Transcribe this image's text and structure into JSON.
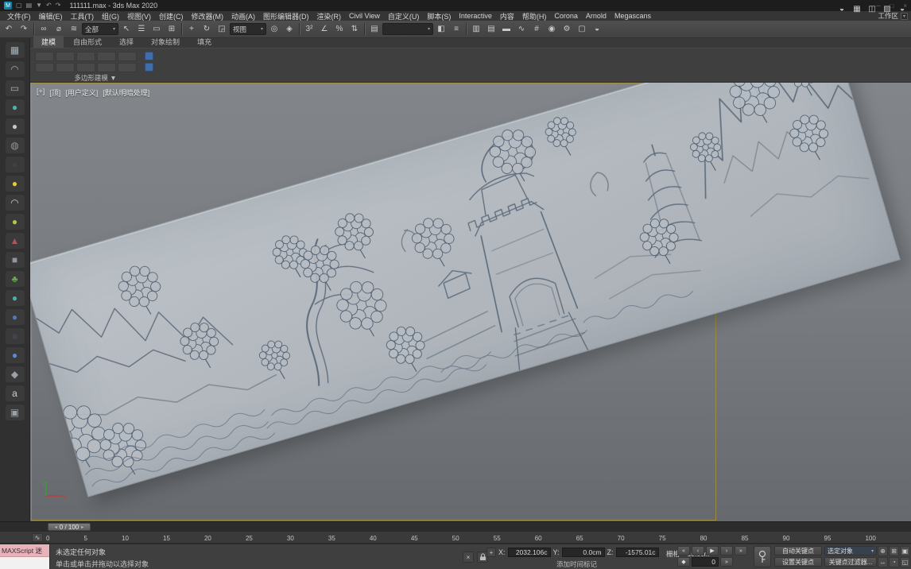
{
  "window": {
    "title": "111111.max - 3ds Max 2020",
    "logo": "M",
    "controls": [
      "─",
      "□",
      "×"
    ]
  },
  "quick_access": {
    "icons": [
      {
        "n": "new-file-icon",
        "g": "▢"
      },
      {
        "n": "open-file-icon",
        "g": "▤"
      },
      {
        "n": "save-file-icon",
        "g": "▼"
      },
      {
        "n": "undo-small-icon",
        "g": "↶"
      },
      {
        "n": "redo-small-icon",
        "g": "↷"
      }
    ]
  },
  "menu_bar": {
    "items": [
      "文件(F)",
      "编辑(E)",
      "工具(T)",
      "组(G)",
      "视图(V)",
      "创建(C)",
      "修改器(M)",
      "动画(A)",
      "图形编辑器(D)",
      "渲染(R)",
      "Civil View",
      "自定义(U)",
      "脚本(S)",
      "Interactive",
      "内容",
      "帮助(H)",
      "Corona",
      "Arnold",
      "Megascans"
    ],
    "workspace_label": "工作区"
  },
  "toolbar": {
    "buttons": [
      {
        "t": "i",
        "n": "undo-icon",
        "g": "↶"
      },
      {
        "t": "i",
        "n": "redo-icon",
        "g": "↷"
      },
      {
        "t": "s"
      },
      {
        "t": "i",
        "n": "select-and-link-icon",
        "g": "∞"
      },
      {
        "t": "i",
        "n": "unlink-selection-icon",
        "g": "⌀"
      },
      {
        "t": "i",
        "n": "bind-to-space-warp-icon",
        "g": "≋"
      },
      {
        "t": "d",
        "n": "selection-filter-dropdown",
        "v": "全部"
      },
      {
        "t": "i",
        "n": "select-object-icon",
        "g": "↖"
      },
      {
        "t": "i",
        "n": "select-by-name-icon",
        "g": "☰"
      },
      {
        "t": "i",
        "n": "rectangular-selection-region-icon",
        "g": "▭"
      },
      {
        "t": "i",
        "n": "window-crossing-icon",
        "g": "⊞"
      },
      {
        "t": "s"
      },
      {
        "t": "i",
        "n": "select-and-move-icon",
        "g": "+"
      },
      {
        "t": "i",
        "n": "select-and-rotate-icon",
        "g": "↻"
      },
      {
        "t": "i",
        "n": "select-and-scale-icon",
        "g": "◲"
      },
      {
        "t": "d",
        "n": "reference-coordinate-dropdown",
        "v": "视图"
      },
      {
        "t": "i",
        "n": "use-pivot-point-icon",
        "g": "◎"
      },
      {
        "t": "i",
        "n": "select-and-manipulate-icon",
        "g": "◈"
      },
      {
        "t": "s"
      },
      {
        "t": "i",
        "n": "snaps-toggle-icon",
        "g": "3²"
      },
      {
        "t": "i",
        "n": "angle-snap-icon",
        "g": "∠"
      },
      {
        "t": "i",
        "n": "percent-snap-icon",
        "g": "%"
      },
      {
        "t": "i",
        "n": "spinner-snap-icon",
        "g": "⇅"
      },
      {
        "t": "s"
      },
      {
        "t": "i",
        "n": "edit-named-selection-sets-icon",
        "g": "▤"
      },
      {
        "t": "w",
        "n": "named-selection-sets-dropdown",
        "v": ""
      },
      {
        "t": "i",
        "n": "mirror-icon",
        "g": "◧"
      },
      {
        "t": "i",
        "n": "align-icon",
        "g": "≡"
      },
      {
        "t": "s"
      },
      {
        "t": "i",
        "n": "toggle-scene-explorer-icon",
        "g": "▥"
      },
      {
        "t": "i",
        "n": "toggle-layer-explorer-icon",
        "g": "▤"
      },
      {
        "t": "i",
        "n": "toggle-ribbon-icon",
        "g": "▬"
      },
      {
        "t": "i",
        "n": "curve-editor-icon",
        "g": "∿"
      },
      {
        "t": "i",
        "n": "schematic-view-icon",
        "g": "#"
      },
      {
        "t": "i",
        "n": "material-editor-icon",
        "g": "◉"
      },
      {
        "t": "i",
        "n": "render-setup-icon",
        "g": "⚙"
      },
      {
        "t": "i",
        "n": "rendered-frame-window-icon",
        "g": "▢"
      },
      {
        "t": "i",
        "n": "render-production-icon",
        "g": "◒"
      }
    ],
    "right_icons": [
      {
        "n": "toolbar-right-render-icon",
        "g": "◒"
      },
      {
        "n": "toolbar-right-state-sets-icon",
        "g": "▦"
      },
      {
        "n": "toolbar-right-material-icon",
        "g": "◫"
      },
      {
        "n": "toolbar-right-explorer-icon",
        "g": "▨"
      },
      {
        "n": "toolbar-right-teapot-icon",
        "g": "◒"
      }
    ]
  },
  "ribbon": {
    "tabs": [
      "建模",
      "自由形式",
      "选择",
      "对象绘制",
      "填充"
    ],
    "active": "建模",
    "panel_label": "多边形建模 ▼"
  },
  "side_toolbar": {
    "icons": [
      {
        "n": "side-grid-tool-icon",
        "g": "▦",
        "c": "#9fb2bd"
      },
      {
        "n": "side-arc-tool-icon",
        "g": "◠",
        "c": "#a8adb2"
      },
      {
        "n": "side-plane-tool-icon",
        "g": "▭",
        "c": "#a8adb2"
      },
      {
        "n": "side-teal-sphere-tool-icon",
        "g": "●",
        "c": "#52b2a8"
      },
      {
        "n": "side-gray-sphere-tool-icon",
        "g": "●",
        "c": "#c2c7cc"
      },
      {
        "n": "side-ring-tool-icon",
        "g": "◍",
        "c": "#8f959b"
      },
      {
        "n": "side-dark-sphere-tool-icon",
        "g": "●",
        "c": "#3d434b"
      },
      {
        "n": "side-yellow-sphere-tool-icon",
        "g": "●",
        "c": "#e6c93c"
      },
      {
        "n": "side-dome-tool-icon",
        "g": "◠",
        "c": "#c8ccd1"
      },
      {
        "n": "side-olive-sphere-tool-icon",
        "g": "●",
        "c": "#b8c24a"
      },
      {
        "n": "side-red-cone-tool-icon",
        "g": "▲",
        "c": "#b05555"
      },
      {
        "n": "side-box-tool-icon",
        "g": "■",
        "c": "#8f959b"
      },
      {
        "n": "side-plant-tool-icon",
        "g": "♣",
        "c": "#6aa84f"
      },
      {
        "n": "side-teal2-sphere-tool-icon",
        "g": "●",
        "c": "#49b0a0"
      },
      {
        "n": "side-blue-sphere-tool-icon",
        "g": "●",
        "c": "#4f7ab5"
      },
      {
        "n": "side-dark-box-tool-icon",
        "g": "■",
        "c": "#41464d"
      },
      {
        "n": "side-blue2-sphere-tool-icon",
        "g": "●",
        "c": "#5b8bd0"
      },
      {
        "n": "side-diamond-tool-icon",
        "g": "◆",
        "c": "#9aa0a6"
      },
      {
        "n": "side-text-tool-icon",
        "g": "a",
        "c": "#ccd0d4"
      },
      {
        "n": "side-material-tool-icon",
        "g": "▣",
        "c": "#9aa0a6"
      }
    ]
  },
  "viewport": {
    "label_plus": "[+]",
    "label_view": "[顶]",
    "label_user": "[用户定义]",
    "label_shading": "[默认明暗处理]",
    "axis_x": "x",
    "axis_y": "y"
  },
  "timeline": {
    "slider_label": "0 / 100",
    "ticks": [
      "0",
      "5",
      "10",
      "15",
      "20",
      "25",
      "30",
      "35",
      "40",
      "45",
      "50",
      "55",
      "60",
      "65",
      "70",
      "75",
      "80",
      "85",
      "90",
      "95",
      "100"
    ]
  },
  "status_bar": {
    "listener_text": "MAXScript 迷",
    "status": "未选定任何对象",
    "prompt": "单击或单击并拖动以选择对象",
    "coords": {
      "x_label": "X:",
      "x": "2032.106c",
      "y_label": "Y:",
      "y": "0.0cm",
      "z_label": "Z:",
      "z": "-1575.01c"
    },
    "grid": "栅格 = 10.0cm",
    "time_tag": "添加时间标记"
  },
  "animation": {
    "frame": "0",
    "auto_key": "自动关键点",
    "set_key": "设置关键点",
    "selected_filter": "选定对象",
    "key_filters": "关键点过滤器...",
    "transport": [
      {
        "n": "go-to-start-button",
        "g": "«"
      },
      {
        "n": "previous-frame-button",
        "g": "‹"
      },
      {
        "n": "play-button",
        "g": "▶"
      },
      {
        "n": "next-frame-button",
        "g": "›"
      },
      {
        "n": "go-to-end-button",
        "g": "»"
      }
    ],
    "key_mode_glyph": "◆"
  },
  "navigation": {
    "icons": [
      {
        "n": "zoom-icon",
        "g": "⊕"
      },
      {
        "n": "zoom-all-icon",
        "g": "⊞"
      },
      {
        "n": "zoom-extents-icon",
        "g": "▣"
      },
      {
        "n": "pan-icon",
        "g": "↔"
      },
      {
        "n": "orbit-icon",
        "g": "◔"
      },
      {
        "n": "maximize-viewport-icon",
        "g": "◱"
      }
    ]
  },
  "colors": {
    "accent_border": "#a89236",
    "plane": "#b3b9bf",
    "relief_line": "#4d5c6e"
  }
}
